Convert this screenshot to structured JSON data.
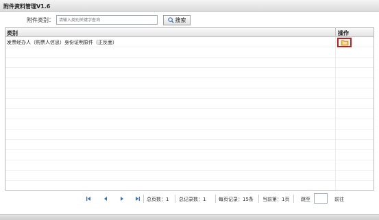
{
  "window": {
    "title": "附件资料管理V1.6"
  },
  "search": {
    "label": "附件类别：",
    "placeholder": "请输入类别关键字查询",
    "button_label": "搜索"
  },
  "grid": {
    "columns": [
      "类别",
      "操作"
    ],
    "rows": [
      {
        "category": "发票经办人（购票人信息）身份证明原件（正反面）",
        "action_icon": "folder-view-icon"
      }
    ]
  },
  "pager": {
    "total_pages_label": "总页数：1",
    "total_records_label": "总记录数：1",
    "per_page_label": "每页记录：15条",
    "current_page_label": "当前第：1页",
    "jump_label": "跳至",
    "go_label": "前往"
  }
}
